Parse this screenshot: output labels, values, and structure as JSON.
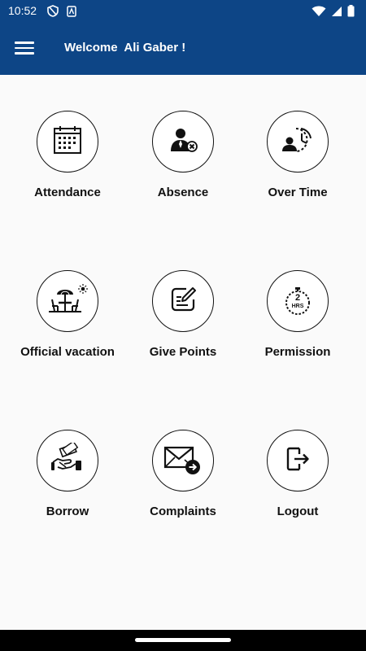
{
  "status_bar": {
    "time": "10:52",
    "icons_left": [
      "shield-icon",
      "sim-icon"
    ],
    "icons_right": [
      "wifi-icon",
      "signal-icon",
      "battery-icon"
    ]
  },
  "app_bar": {
    "title": "Welcome  Ali Gaber !",
    "menu_icon": "hamburger-menu-icon",
    "background_color": "#0d4586"
  },
  "tiles": [
    {
      "label": "Attendance",
      "icon": "calendar-icon"
    },
    {
      "label": "Absence",
      "icon": "person-remove-icon"
    },
    {
      "label": "Over Time",
      "icon": "person-clock-icon"
    },
    {
      "label": "Official vacation",
      "icon": "cafe-umbrella-icon"
    },
    {
      "label": "Give Points",
      "icon": "edit-note-icon"
    },
    {
      "label": "Permission",
      "icon": "timer-2hrs-icon"
    },
    {
      "label": "Borrow",
      "icon": "money-handshake-icon"
    },
    {
      "label": "Complaints",
      "icon": "envelope-arrow-icon"
    },
    {
      "label": "Logout",
      "icon": "logout-icon"
    }
  ],
  "timer_badge": {
    "number": "2",
    "unit": "HRS"
  }
}
